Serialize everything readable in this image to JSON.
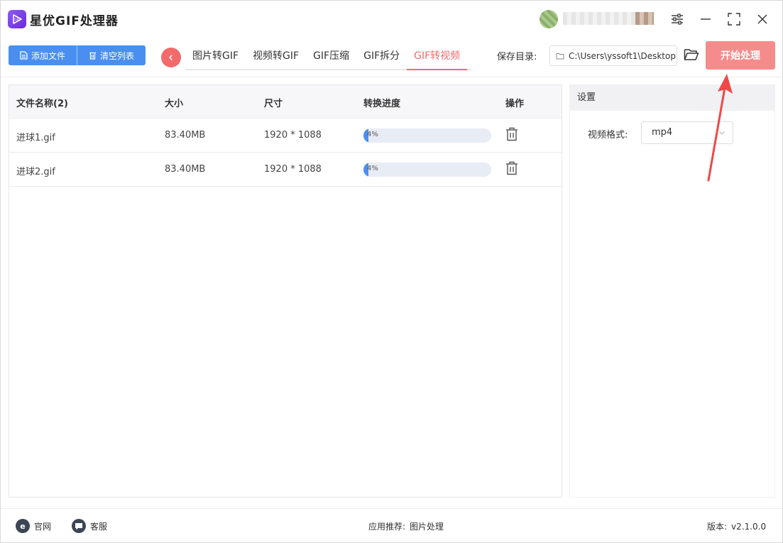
{
  "app": {
    "title": "星优GIF处理器",
    "logo_text": "GIF"
  },
  "toolbar": {
    "add_file_label": "添加文件",
    "clear_list_label": "清空列表",
    "tabs": [
      {
        "label": "图片转GIF",
        "active": false
      },
      {
        "label": "视频转GIF",
        "active": false
      },
      {
        "label": "GIF压缩",
        "active": false
      },
      {
        "label": "GIF拆分",
        "active": false
      },
      {
        "label": "GIF转视频",
        "active": true
      }
    ],
    "save_dir_label": "保存目录:",
    "save_dir_value": "C:\\Users\\yssoft1\\Desktop",
    "start_label": "开始处理"
  },
  "table": {
    "headers": {
      "name": "文件名称(2)",
      "size": "大小",
      "dimensions": "尺寸",
      "progress": "转换进度",
      "action": "操作"
    },
    "rows": [
      {
        "name": "进球1.gif",
        "size": "83.40MB",
        "dimensions": "1920 * 1088",
        "progress_text": "4%",
        "progress": 0.04
      },
      {
        "name": "进球2.gif",
        "size": "83.40MB",
        "dimensions": "1920 * 1088",
        "progress_text": "4%",
        "progress": 0.04
      }
    ]
  },
  "settings": {
    "title": "设置",
    "format_label": "视频格式:",
    "format_value": "mp4"
  },
  "footer": {
    "website_label": "官网",
    "service_label": "客服",
    "recommend_label": "应用推荐:",
    "recommend_value": "图片处理",
    "version_label": "版本:",
    "version_value": "v2.1.0.0"
  },
  "colors": {
    "primary": "#4a8ff0",
    "accent": "#f06c6c",
    "start_button": "#f58c8c",
    "logo": "#7c4dff"
  },
  "icons": {
    "logo": "app-logo-icon",
    "settings": "sliders-icon",
    "minimize": "minimize-icon",
    "maximize": "maximize-icon",
    "close": "close-icon",
    "add": "file-add-icon",
    "clear": "trash-icon",
    "back": "chevron-left-icon",
    "folder": "folder-open-icon",
    "delete": "trash-icon",
    "web": "browser-e-icon",
    "service": "chat-bubble-icon"
  }
}
